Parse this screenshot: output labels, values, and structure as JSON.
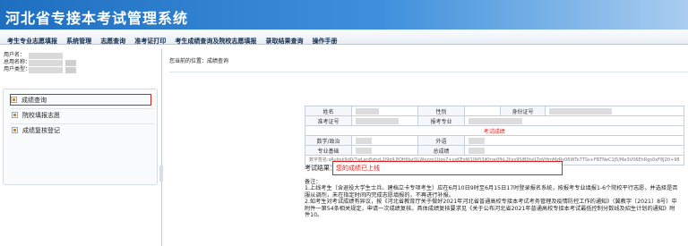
{
  "header": {
    "title": "河北省专接本考试管理系统"
  },
  "menu": [
    "考生专业志愿填报",
    "系统管理",
    "志愿查询",
    "准考证打印",
    "考生成绩查询及院校志愿填报",
    "录取结果查询",
    "操作手册"
  ],
  "user": {
    "username_label": "用户名：",
    "fullname_label": "总用名称：",
    "type_label": "用户类型："
  },
  "nav": {
    "items": [
      {
        "label": "成绩查询"
      },
      {
        "label": "院校填报志愿"
      },
      {
        "label": "成绩复核登记"
      }
    ]
  },
  "breadcrumb": "您当前的位置：成绩查询",
  "info_table": {
    "name_label": "姓名",
    "gender_label": "性别",
    "id_label": "身份证号",
    "exam_no_label": "准考证号",
    "major_label": "报考专业",
    "section_title": "考试成绩",
    "math_label": "数学/政治",
    "foreign_label": "外语",
    "prof_label": "专业基础",
    "total_label": "总成绩",
    "signature": "数字签名:sRubsk9d0/7wLan8xhzL2i9gIL8OHIlbzI1LWxzzo1Ups7+vsKEgW10tPj3jKhse0fkL2lixs9SjB0tsILTgVHmMzRy06WTo7TSs+FBTNeC1J5/Me3V06EhRgs0xF8J20+98"
  },
  "result": {
    "label": "考试结果：",
    "value": "您的成绩已上线"
  },
  "notes": {
    "heading": "备注：",
    "line1": "1.上线考生（含退役大学生士兵、建档立卡专项考生）应在6月10日9时至6月15日17时登录报名系统，按报考专业填报1-6个院校平行志愿，并选择是否服从调剂，未在指定时间内完成志愿填报的，不再进行补报。",
    "line2": "2.如考生对考试成绩有异议，按《河北省教育厅关于做好2021年河北省普通高校专接本考试考务管理及疫情防控工作的通知》（冀教字〔2021〕8号）中附件一第54条相关规定，申请一次成绩复核。具体成绩复核要求见《关于公布河北省2021年普通高校专接本考试最低控制分数线及招生计划的通知》附件10。"
  }
}
